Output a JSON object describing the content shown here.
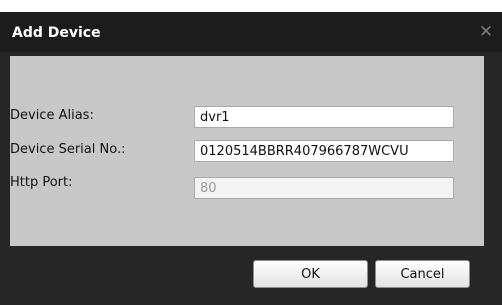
{
  "dialog": {
    "title": "Add Device",
    "close_glyph": "✕",
    "close_icon": "close-icon"
  },
  "form": {
    "device_alias": {
      "label": "Device Alias:",
      "value": "dvr1"
    },
    "device_serial": {
      "label": "Device Serial No.:",
      "value": "0120514BBRR407966787WCVU"
    },
    "http_port": {
      "label": "Http Port:",
      "value": "80",
      "disabled": true
    }
  },
  "buttons": {
    "ok_label": "OK",
    "cancel_label": "Cancel"
  },
  "colors": {
    "title_bar": "#1c1c1c",
    "dialog_body": "#262626",
    "form_panel": "#c8c8c8"
  }
}
